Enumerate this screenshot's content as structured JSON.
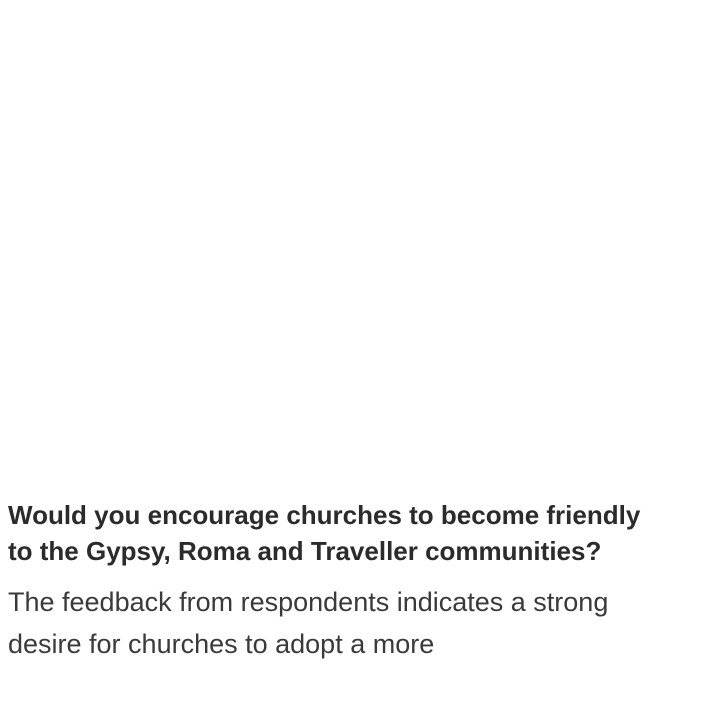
{
  "article": {
    "question": "Would you encourage churches to become friendly to the Gypsy, Roma and Traveller communities?",
    "body": "The feedback from respondents indicates a strong desire for churches to adopt a more"
  }
}
